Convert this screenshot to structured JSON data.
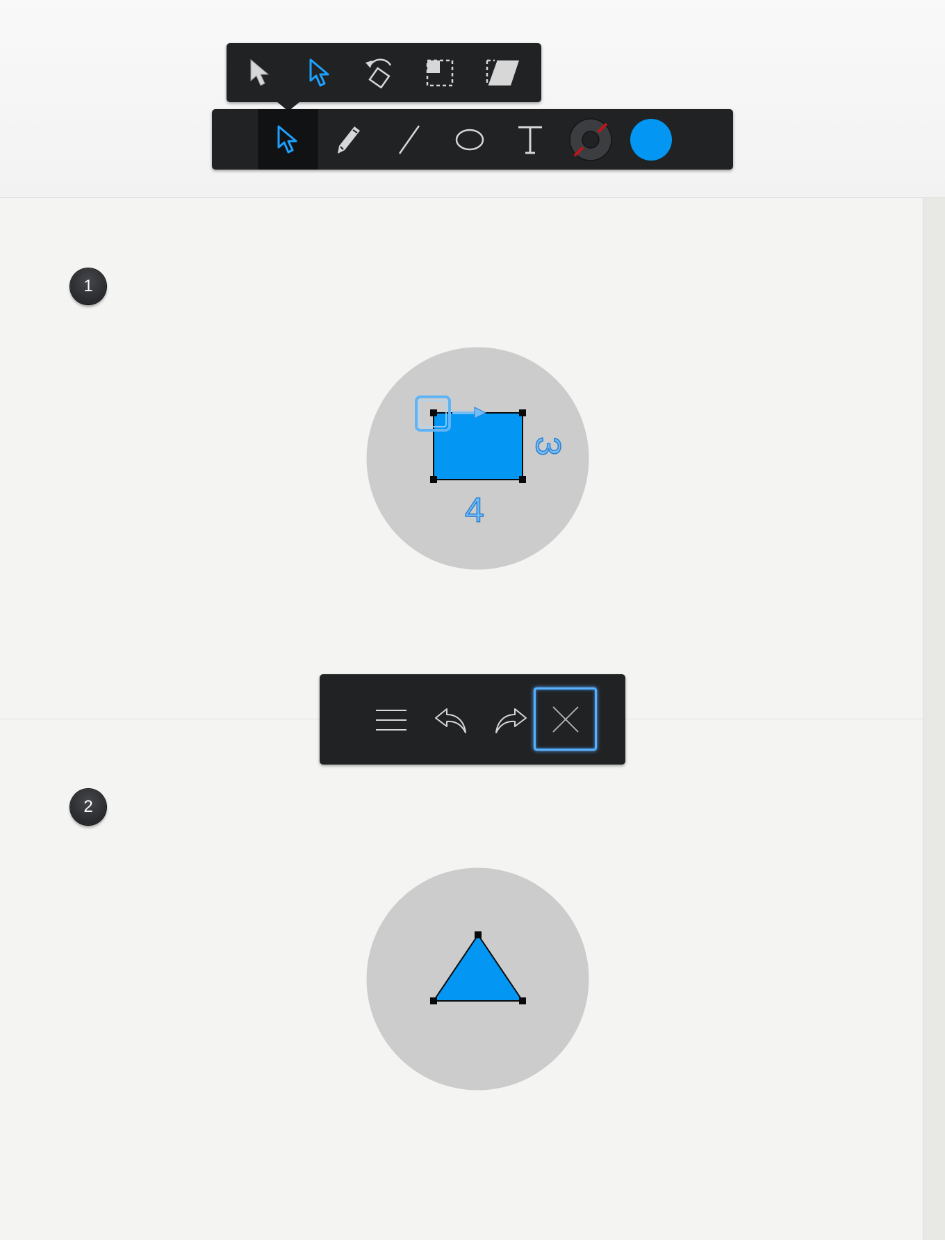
{
  "colors": {
    "accent": "#0397f3",
    "toolbar_bg": "#212224",
    "canvas_bg": "#f4f5f2",
    "stage_circle": "#cccccc",
    "stroke_swatch_red": "#c0141b",
    "fill_swatch": "#0397f3"
  },
  "select_submenu": {
    "items": [
      {
        "icon": "select-arrow-icon"
      },
      {
        "icon": "direct-select-arrow-icon",
        "active": true
      },
      {
        "icon": "rotate-icon"
      },
      {
        "icon": "scale-icon"
      },
      {
        "icon": "skew-icon"
      }
    ]
  },
  "main_toolbar": {
    "items": [
      {
        "icon": "select-tool-icon",
        "active": true
      },
      {
        "icon": "pencil-icon"
      },
      {
        "icon": "line-icon"
      },
      {
        "icon": "ellipse-icon"
      },
      {
        "icon": "text-icon"
      },
      {
        "icon": "stroke-color-swatch"
      },
      {
        "icon": "fill-color-swatch"
      }
    ]
  },
  "steps": [
    {
      "number": "1",
      "shape": "rectangle",
      "dimension_labels": {
        "width": "4",
        "height": "3"
      }
    },
    {
      "number": "2",
      "shape": "triangle"
    }
  ],
  "edit_toolbar": {
    "items": [
      {
        "icon": "menu-icon"
      },
      {
        "icon": "undo-icon"
      },
      {
        "icon": "redo-icon"
      },
      {
        "icon": "close-icon",
        "highlighted": true
      }
    ]
  }
}
